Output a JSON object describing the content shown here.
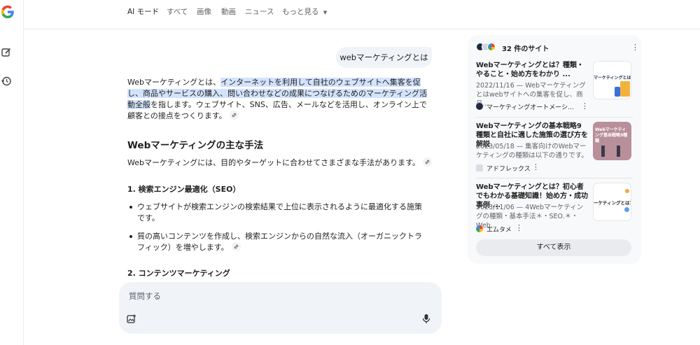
{
  "tabs": {
    "ai_mode": "AI モード",
    "all": "すべて",
    "images": "画像",
    "videos": "動画",
    "news": "ニュース",
    "more": "もっと見る"
  },
  "query": "webマーケティングとは",
  "answer": {
    "intro_a": "Webマーケティングとは、",
    "intro_hl": "インターネットを利用して自社のウェブサイトへ集客を促し、商品やサービスの購入、問い合わせなどの成果につなげるためのマーケティング活動全般",
    "intro_b": "を指します。ウェブサイト、SNS、広告、メールなどを活用し、オンライン上で顧客との接点をつくります。",
    "heading": "Webマーケティングの主な手法",
    "lead": "Webマーケティングには、目的やターゲットに合わせてさまざまな手法があります。",
    "sec1_title": "1. 検索エンジン最適化（SEO）",
    "sec1_b1": "ウェブサイトが検索エンジンの検索結果で上位に表示されるように最適化する施策です。",
    "sec1_b2": "質の高いコンテンツを作成し、検索エンジンからの自然な流入（オーガニックトラフィック）を増やします。",
    "sec2_title": "2. コンテンツマーケティング"
  },
  "input": {
    "placeholder": "質問する"
  },
  "sources": {
    "count_label": "32 件のサイト",
    "cards": [
      {
        "title": "Webマーケティングとは？種類・やること・始め方をわかり ...",
        "snippet": "2022/11/16 — Webマーケティングとはwebサイトへの集客を促し、商品...",
        "source": "マーケティングオートメーシ...",
        "thumb_text": "マーケティングとは？"
      },
      {
        "title": "Webマーケティングの基本戦略9種類と自社に適した施策の選び方を解説",
        "snippet": "2023/05/18 — 集客向けのWebマーケティングの種類は以下の通りです。",
        "source": "アドフレックス",
        "thumb_text": "Webマーケティング基本戦略9種類"
      },
      {
        "title": "Webマーケティングとは？初心者でもわかる基礎知識！始め方・成功事例 ...",
        "snippet": "2023/11/06 — 4Webマーケティングの種類・基本手法＊・SEO.＊・Web...",
        "source": "エムタメ",
        "thumb_text": "ーケティングとは？"
      }
    ],
    "show_all": "すべて表示"
  },
  "colors": {
    "highlight": "#d3e3fd",
    "bubble": "#f0f4f9",
    "panel": "#f8f9fa",
    "thumb2": "#b98f9c"
  }
}
